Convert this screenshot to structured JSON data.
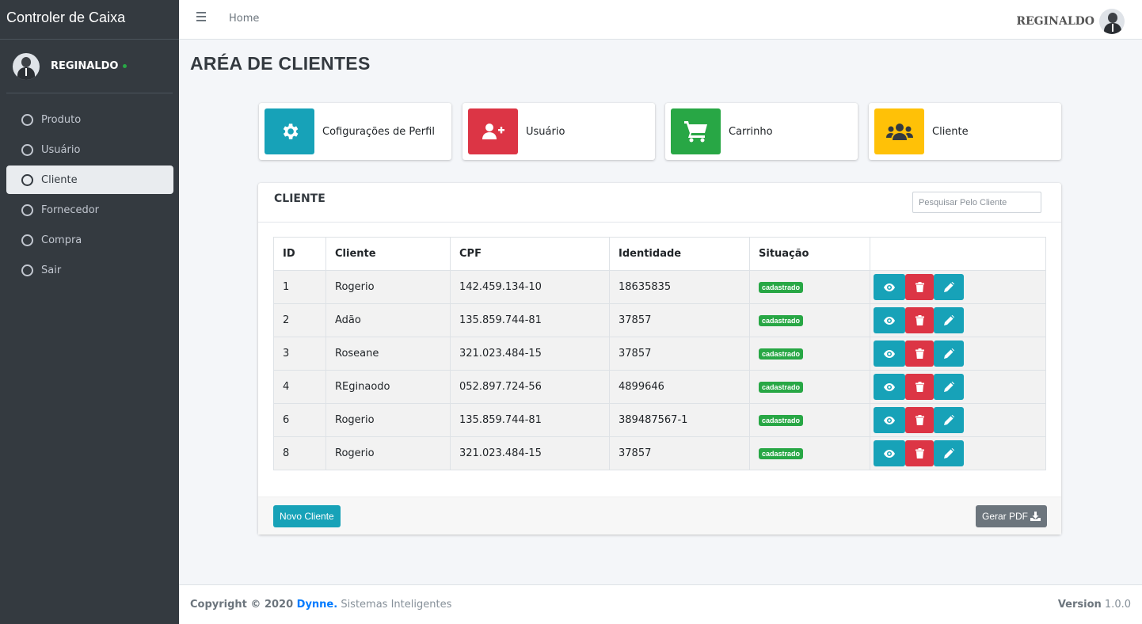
{
  "sidebar": {
    "brand": "Controler de Caixa",
    "user_name": "REGINALDO",
    "items": [
      {
        "label": "Produto"
      },
      {
        "label": "Usuário"
      },
      {
        "label": "Cliente"
      },
      {
        "label": "Fornecedor"
      },
      {
        "label": "Compra"
      },
      {
        "label": "Sair"
      }
    ],
    "active_item": "Cliente"
  },
  "topbar": {
    "breadcrumb": "Home",
    "user_name": "REGINALDO"
  },
  "page": {
    "title": "ARÉA DE CLIENTES"
  },
  "shortcuts": [
    {
      "label": "Cofigurações de Perfil",
      "icon": "gear-icon",
      "color": "#17a2b8"
    },
    {
      "label": "Usuário",
      "icon": "user-plus-icon",
      "color": "#dc3545"
    },
    {
      "label": "Carrinho",
      "icon": "cart-icon",
      "color": "#28a745"
    },
    {
      "label": "Cliente",
      "icon": "users-icon",
      "color": "#ffc107"
    }
  ],
  "client_card": {
    "title": "CLIENTE",
    "search_placeholder": "Pesquisar Pelo Cliente",
    "columns": [
      "ID",
      "Cliente",
      "CPF",
      "Identidade",
      "Situação"
    ],
    "rows": [
      {
        "id": "1",
        "cliente": "Rogerio",
        "cpf": "142.459.134-10",
        "identidade": "18635835",
        "situacao": "cadastrado"
      },
      {
        "id": "2",
        "cliente": "Adão",
        "cpf": "135.859.744-81",
        "identidade": "37857",
        "situacao": "cadastrado"
      },
      {
        "id": "3",
        "cliente": "Roseane",
        "cpf": "321.023.484-15",
        "identidade": "37857",
        "situacao": "cadastrado"
      },
      {
        "id": "4",
        "cliente": "REginaodo",
        "cpf": "052.897.724-56",
        "identidade": "4899646",
        "situacao": "cadastrado"
      },
      {
        "id": "6",
        "cliente": "Rogerio",
        "cpf": "135.859.744-81",
        "identidade": "389487567-1",
        "situacao": "cadastrado"
      },
      {
        "id": "8",
        "cliente": "Rogerio",
        "cpf": "321.023.484-15",
        "identidade": "37857",
        "situacao": "cadastrado"
      }
    ],
    "new_button": "Novo Cliente",
    "pdf_button": "Gerar PDF"
  },
  "footer": {
    "copyright_prefix": "Copyright © 2020 ",
    "company": "Dynne.",
    "tagline": " Sistemas Inteligentes",
    "version_label": "Version",
    "version_value": " 1.0.0"
  },
  "colors": {
    "sidebar_bg": "#343a40",
    "info": "#17a2b8",
    "danger": "#dc3545",
    "success": "#28a745",
    "warning": "#ffc107",
    "secondary": "#6c757d",
    "link": "#007bff"
  }
}
